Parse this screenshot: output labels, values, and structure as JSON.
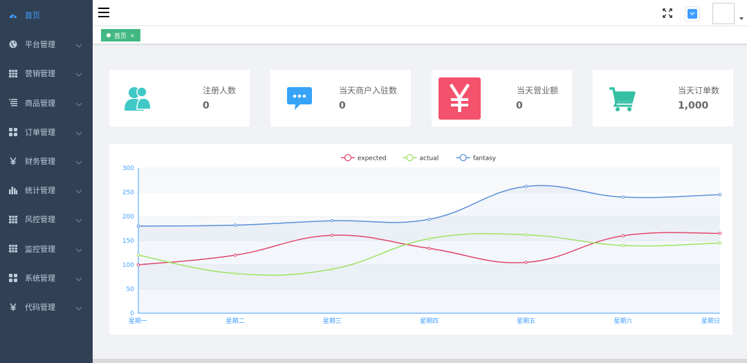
{
  "sidebar": {
    "items": [
      {
        "label": "首页",
        "icon": "dashboard-icon",
        "active": true,
        "has_arrow": false
      },
      {
        "label": "平台管理",
        "icon": "globe-icon",
        "active": false,
        "has_arrow": true
      },
      {
        "label": "营销管理",
        "icon": "table-icon",
        "active": false,
        "has_arrow": true
      },
      {
        "label": "商品管理",
        "icon": "list-icon",
        "active": false,
        "has_arrow": true
      },
      {
        "label": "订单管理",
        "icon": "grid-icon",
        "active": false,
        "has_arrow": true
      },
      {
        "label": "财务管理",
        "icon": "yen-icon",
        "active": false,
        "has_arrow": true
      },
      {
        "label": "统计管理",
        "icon": "bar-chart-icon",
        "active": false,
        "has_arrow": true
      },
      {
        "label": "风控管理",
        "icon": "table-icon",
        "active": false,
        "has_arrow": true
      },
      {
        "label": "监控管理",
        "icon": "table-icon",
        "active": false,
        "has_arrow": true
      },
      {
        "label": "系统管理",
        "icon": "grid-icon",
        "active": false,
        "has_arrow": true
      },
      {
        "label": "代码管理",
        "icon": "yen-icon",
        "active": false,
        "has_arrow": true
      }
    ]
  },
  "tags": [
    {
      "label": "首页",
      "close": "×"
    }
  ],
  "cards": [
    {
      "title": "注册人数",
      "value": "0",
      "icon": "users-icon",
      "color": "#40c9c6"
    },
    {
      "title": "当天商户入驻数",
      "value": "0",
      "icon": "message-icon",
      "color": "#36a3f7"
    },
    {
      "title": "当天营业额",
      "value": "0",
      "icon": "yen-icon",
      "color": "#f4516c"
    },
    {
      "title": "当天订单数",
      "value": "1,000",
      "icon": "shopping-cart-icon",
      "color": "#34bfa3"
    }
  ],
  "colors": {
    "sidebar_bg": "#304156",
    "sidebar_text": "#bfcbd9",
    "active": "#409eff",
    "tag": "#42b983"
  },
  "chart_data": {
    "type": "line",
    "categories": [
      "星期一",
      "星期二",
      "星期三",
      "星期四",
      "星期五",
      "星期六",
      "星期日"
    ],
    "series": [
      {
        "name": "expected",
        "values": [
          100,
          120,
          161,
          134,
          105,
          160,
          165
        ],
        "color": "#e0456b"
      },
      {
        "name": "actual",
        "values": [
          120,
          82,
          91,
          154,
          162,
          140,
          145
        ],
        "color": "#9fe060"
      },
      {
        "name": "fantasy",
        "values": [
          180,
          182,
          191,
          194,
          262,
          240,
          245
        ],
        "color": "#5a8fd8",
        "area": true
      }
    ],
    "ylim": [
      0,
      300
    ],
    "yticks": [
      0,
      50,
      100,
      150,
      200,
      250,
      300
    ],
    "legend_position": "top-center",
    "grid": true
  }
}
